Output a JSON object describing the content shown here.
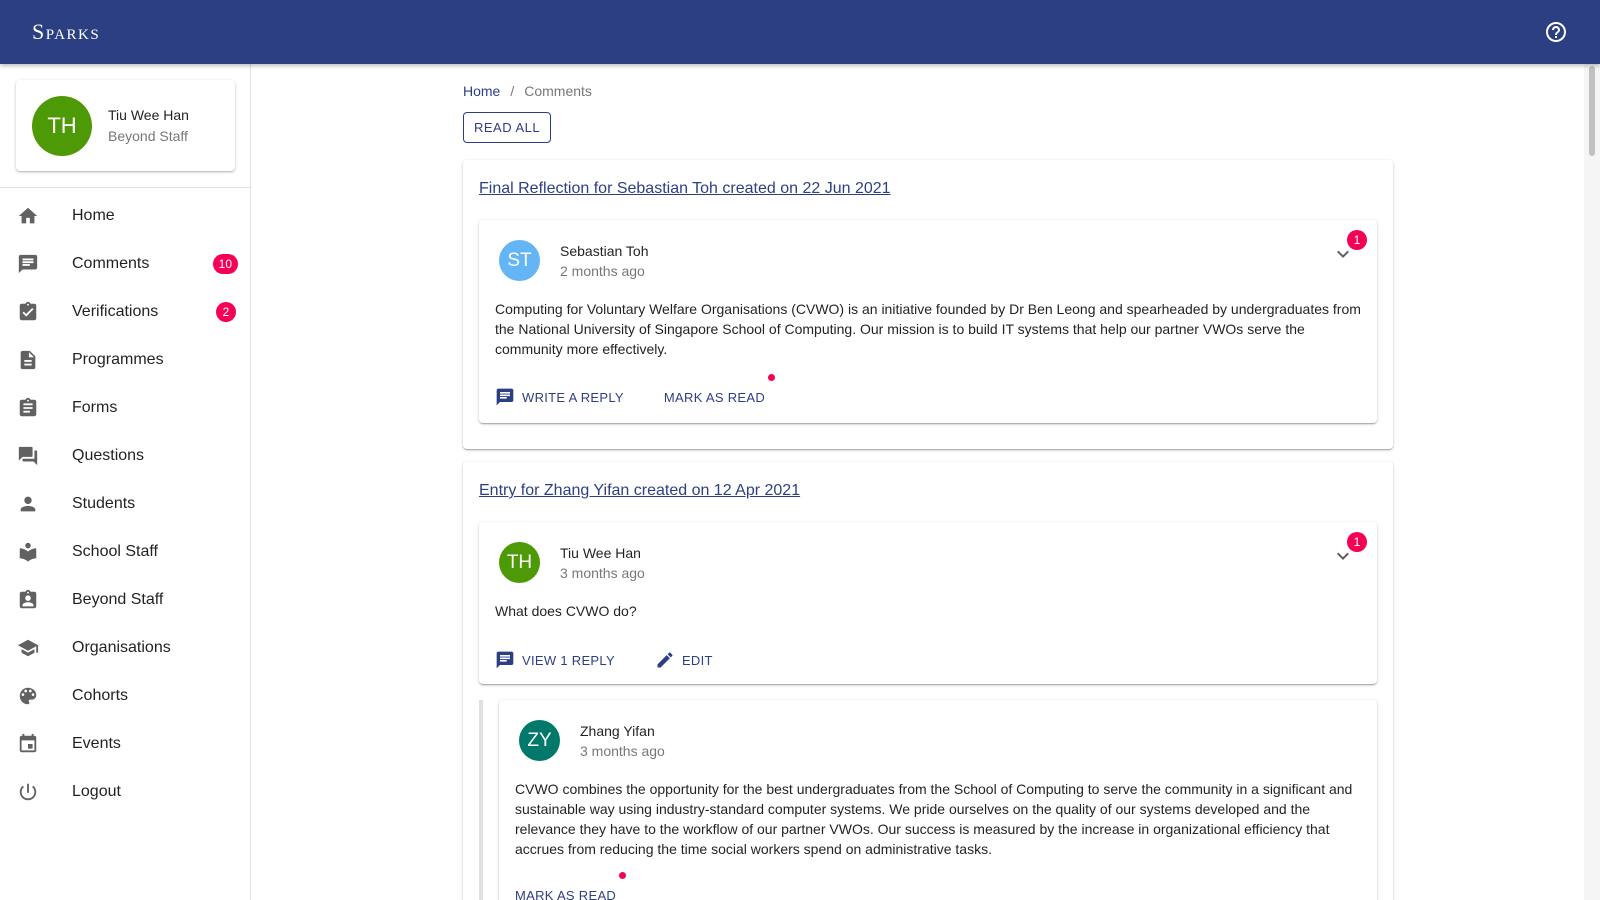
{
  "app": {
    "brand": "Sparks",
    "help_icon": "help-circle-icon"
  },
  "colors": {
    "appbar": "#2d3f83",
    "badge": "#f50057",
    "avatar_th": "#4e9a06",
    "avatar_st": "#64b5f6",
    "avatar_zy": "#00796b"
  },
  "profile": {
    "initials": "TH",
    "name": "Tiu Wee Han",
    "role": "Beyond Staff"
  },
  "sidebar": {
    "items": [
      {
        "label": "Home",
        "icon": "home-icon"
      },
      {
        "label": "Comments",
        "icon": "comment-icon",
        "badge": "10"
      },
      {
        "label": "Verifications",
        "icon": "assignment-turned-in-icon",
        "badge": "2"
      },
      {
        "label": "Programmes",
        "icon": "description-icon"
      },
      {
        "label": "Forms",
        "icon": "assignment-icon"
      },
      {
        "label": "Questions",
        "icon": "forum-icon"
      },
      {
        "label": "Students",
        "icon": "person-icon"
      },
      {
        "label": "School Staff",
        "icon": "local-library-icon"
      },
      {
        "label": "Beyond Staff",
        "icon": "assignment-ind-icon"
      },
      {
        "label": "Organisations",
        "icon": "school-icon"
      },
      {
        "label": "Cohorts",
        "icon": "palette-icon"
      },
      {
        "label": "Events",
        "icon": "event-icon"
      },
      {
        "label": "Logout",
        "icon": "power-icon"
      }
    ]
  },
  "breadcrumb": {
    "home": "Home",
    "separator": "/",
    "current": "Comments"
  },
  "read_all_label": "READ ALL",
  "threads": [
    {
      "title": "Final Reflection for Sebastian Toh created on 22 Jun 2021",
      "comment": {
        "initials": "ST",
        "author": "Sebastian Toh",
        "time": "2 months ago",
        "badge": "1",
        "body": "Computing for Voluntary Welfare Organisations (CVWO) is an initiative founded by Dr Ben Leong and spearheaded by undergraduates from the National University of Singapore School of Computing. Our mission is to build IT systems that help our partner VWOs serve the community more effectively.",
        "actions": [
          "WRITE A REPLY",
          "MARK AS READ"
        ]
      }
    },
    {
      "title": "Entry for Zhang Yifan created on 12 Apr 2021",
      "comment": {
        "initials": "TH",
        "author": "Tiu Wee Han",
        "time": "3 months ago",
        "badge": "1",
        "body": "What does CVWO do?",
        "actions": [
          "VIEW 1 REPLY",
          "EDIT"
        ]
      },
      "reply": {
        "initials": "ZY",
        "author": "Zhang Yifan",
        "time": "3 months ago",
        "body": "CVWO combines the opportunity for the best undergraduates from the School of Computing to serve the community in a significant and sustainable way using industry-standard computer systems. We pride ourselves on the quality of our systems developed and the relevance they have to the workflow of our partner VWOs. Our success is measured by the increase in organizational efficiency that accrues from reducing the time social workers spend on administrative tasks.",
        "actions": [
          "MARK AS READ"
        ]
      }
    }
  ]
}
